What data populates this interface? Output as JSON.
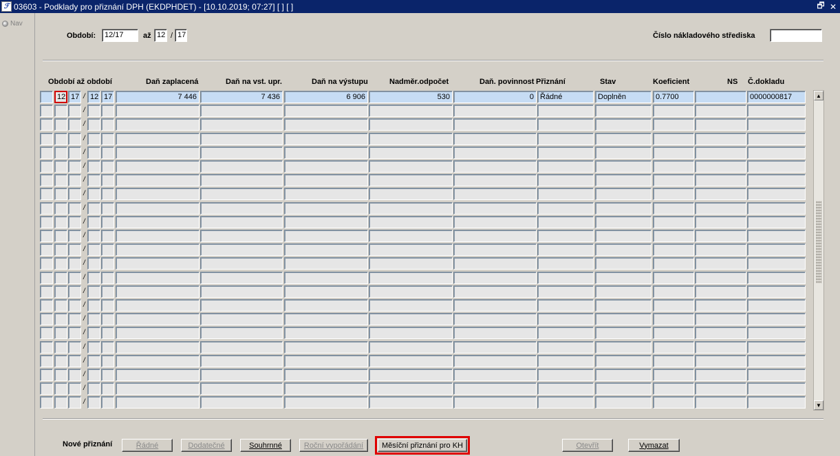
{
  "window": {
    "title": "03603 - Podklady pro přiznání DPH (EKDPHDET) - [10.10.2019; 07:27]  [ ]  [ ]",
    "icon_text": "ℱ",
    "restore_glyph": "🗗",
    "close_glyph": "✕"
  },
  "nav": {
    "label": "Nav"
  },
  "filter": {
    "obdobi_label": "Období:",
    "obdobi_value": "12/17",
    "az_label": "až",
    "az_month": "12",
    "az_sep": "/",
    "az_year": "17",
    "stredisko_label": "Číslo nákladového střediska",
    "stredisko_value": ""
  },
  "columns": {
    "obdobi_az_obdobi": "Období až období",
    "dan_zaplacena": "Daň zaplacená",
    "dan_vst_upr": "Daň na vst. upr.",
    "dan_na_vystupu": "Daň na výstupu",
    "nadmer_odpocet": "Nadměr.odpočet",
    "dan_povinnost": "Daň. povinnost",
    "priznani": "Přiznání",
    "stav": "Stav",
    "koeficient": "Koeficient",
    "ns": "NS",
    "c_dokladu": "Č.dokladu"
  },
  "rows": [
    {
      "od_month": "12",
      "od_year": "17",
      "sep": "/",
      "do_month": "12",
      "do_year": "17",
      "dan_zaplacena": "7 446",
      "dan_vst_upr": "7 436",
      "dan_na_vystupu": "6 906",
      "nadmer_odpocet": "530",
      "dan_povinnost": "0",
      "priznani": "Řádné",
      "stav": "Doplněn",
      "koeficient": "0.7700",
      "ns": "",
      "c_dokladu": "0000000817"
    }
  ],
  "empty_row_count": 22,
  "empty_row_sep": "/",
  "scrollbar": {
    "up_glyph": "▲",
    "down_glyph": "▼"
  },
  "footer": {
    "nove_priznani_label": "Nové přiznání",
    "buttons": {
      "radne": "Řádné",
      "dodatecne": "Dodatečné",
      "souhrnne": "Souhrnné",
      "rocni_vyporadani": "Roční vypořádání",
      "mesicni_priznani_kh": "Měsíční přiznání pro KH",
      "otevrit": "Otevřít",
      "vymazat": "Vymazat"
    }
  },
  "colors": {
    "titlebar": "#0a246a",
    "selected_row": "#c6dcf4",
    "highlight_outline": "#e00000",
    "focus_border": "#d00000"
  }
}
